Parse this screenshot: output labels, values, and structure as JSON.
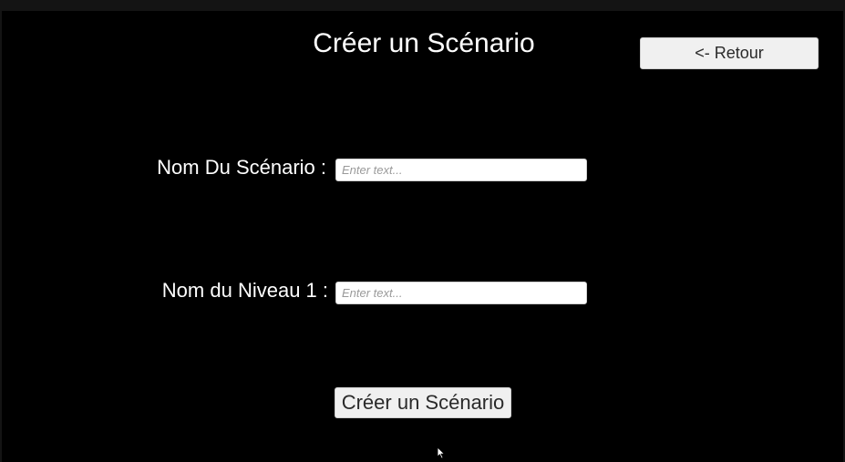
{
  "page": {
    "title": "Créer un Scénario"
  },
  "header": {
    "back_label": "<- Retour"
  },
  "form": {
    "scenario_label": "Nom Du Scénario :",
    "scenario_placeholder": "Enter text...",
    "scenario_value": "",
    "niveau_label": "Nom du Niveau 1 :",
    "niveau_placeholder": "Enter text...",
    "niveau_value": "",
    "submit_label": "Créer un Scénario"
  },
  "icons": {
    "cursor": "mouse-pointer-icon"
  },
  "colors": {
    "background": "#000000",
    "text": "#ffffff",
    "button_bg": "#f0f0f0",
    "button_text": "#2a2a2a",
    "placeholder": "#9a9a9a"
  }
}
